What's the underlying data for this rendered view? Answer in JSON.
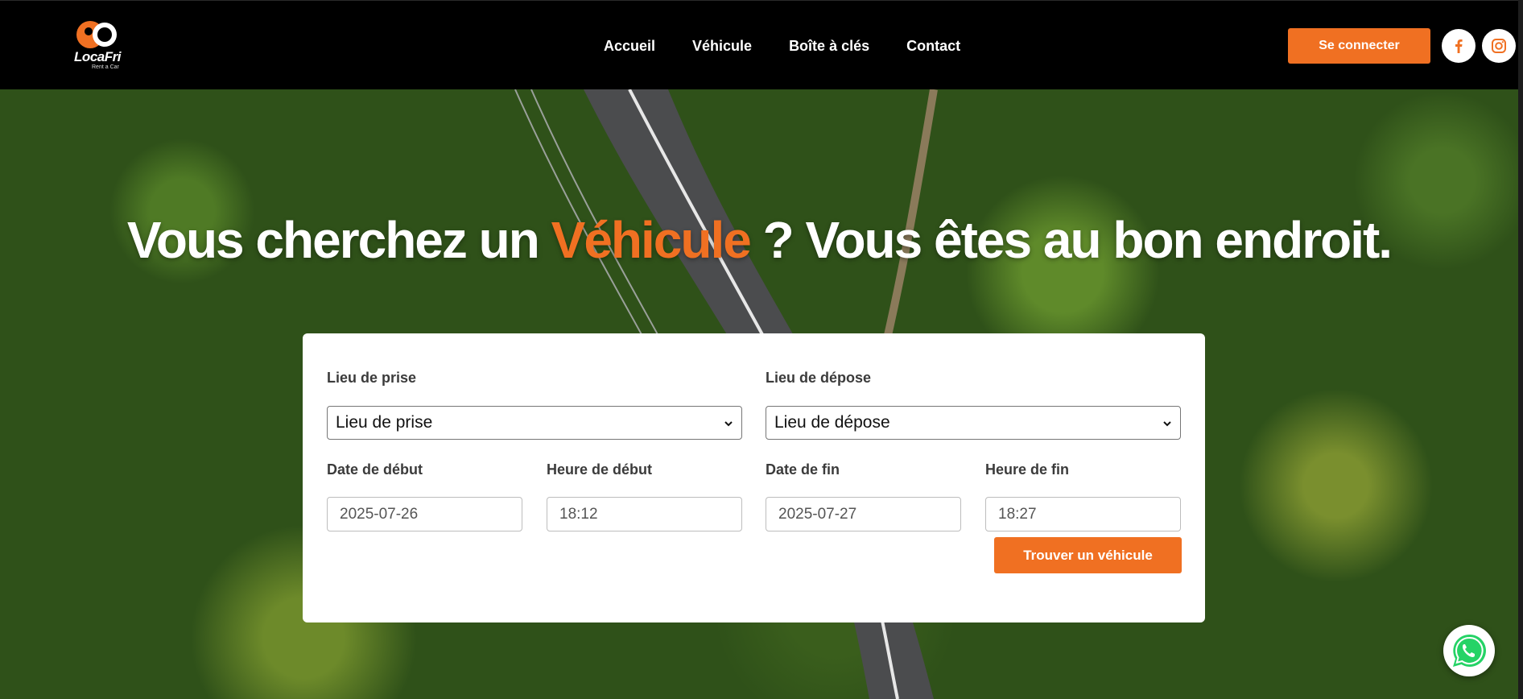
{
  "header": {
    "logo_text": "LocaFri",
    "logo_sub": "Rent a Car",
    "nav": [
      "Accueil",
      "Véhicule",
      "Boîte à clés",
      "Contact"
    ],
    "login_label": "Se connecter"
  },
  "hero": {
    "title_before": "Vous cherchez un",
    "title_accent": "Véhicule",
    "title_after": "? Vous êtes au bon endroit."
  },
  "form": {
    "pickup_label": "Lieu de prise",
    "pickup_value": "Lieu de prise",
    "dropoff_label": "Lieu de dépose",
    "dropoff_value": "Lieu de dépose",
    "start_date_label": "Date de début",
    "start_date_value": "2025-07-26",
    "start_time_label": "Heure de début",
    "start_time_value": "18:12",
    "end_date_label": "Date de fin",
    "end_date_value": "2025-07-27",
    "end_time_label": "Heure de fin",
    "end_time_value": "18:27",
    "submit_label": "Trouver un véhicule"
  },
  "colors": {
    "accent": "#f07022",
    "header_bg": "#000000"
  },
  "icons": [
    "logo-icon",
    "facebook-icon",
    "instagram-icon",
    "chevron-down-icon",
    "whatsapp-icon"
  ]
}
